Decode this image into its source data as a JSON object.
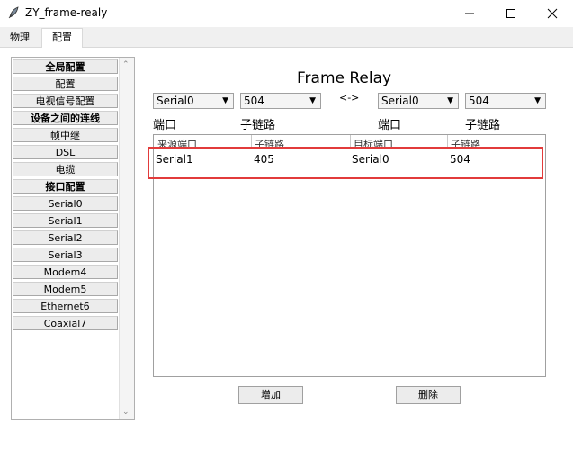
{
  "window": {
    "title": "ZY_frame-realy",
    "icon": "feather-icon"
  },
  "tabs": [
    {
      "label": "物理"
    },
    {
      "label": "配置"
    }
  ],
  "sidebar": {
    "items": [
      {
        "label": "全局配置",
        "header": true
      },
      {
        "label": "配置"
      },
      {
        "label": "电视信号配置"
      },
      {
        "label": "设备之间的连线",
        "header": true
      },
      {
        "label": "帧中继"
      },
      {
        "label": "DSL"
      },
      {
        "label": "电缆"
      },
      {
        "label": "接口配置",
        "header": true
      },
      {
        "label": "Serial0"
      },
      {
        "label": "Serial1"
      },
      {
        "label": "Serial2"
      },
      {
        "label": "Serial3"
      },
      {
        "label": "Modem4"
      },
      {
        "label": "Modem5"
      },
      {
        "label": "Ethernet6"
      },
      {
        "label": "Coaxial7"
      }
    ]
  },
  "main": {
    "title": "Frame Relay",
    "selects": [
      {
        "value": "Serial0"
      },
      {
        "value": "504"
      },
      {
        "value": "Serial0"
      },
      {
        "value": "504"
      }
    ],
    "swap_label": "<->",
    "labels": [
      "端口",
      "子链路",
      "端口",
      "子链路"
    ],
    "table": {
      "headers": [
        "来源端口",
        "子链路",
        "目标端口",
        "子链路"
      ],
      "rows": [
        [
          "Serial1",
          "405",
          "Serial0",
          "504"
        ]
      ]
    },
    "buttons": {
      "add": "增加",
      "delete": "删除"
    }
  },
  "accent": {
    "highlight": "#e23b3b"
  }
}
